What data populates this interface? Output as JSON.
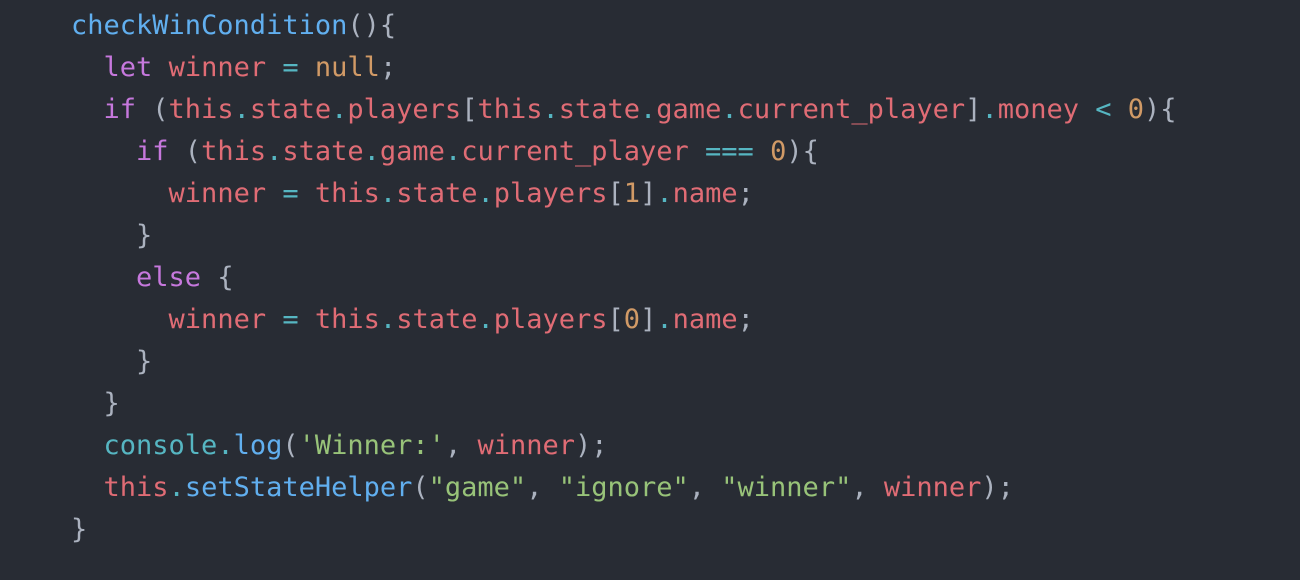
{
  "editor": {
    "theme_colors": {
      "background": "#282c34",
      "function": "#61afef",
      "keyword": "#c678dd",
      "variable": "#e06c75",
      "number": "#d19a66",
      "string": "#98c379",
      "operator": "#56b6c2",
      "punctuation": "#abb2bf"
    },
    "lines": [
      {
        "indent": "",
        "tokens": [
          {
            "t": "checkWinCondition",
            "k": "fn"
          },
          {
            "t": "(){",
            "k": "pun"
          }
        ]
      },
      {
        "indent": "  ",
        "tokens": [
          {
            "t": "let",
            "k": "kw"
          },
          {
            "t": " ",
            "k": "pun"
          },
          {
            "t": "winner",
            "k": "var"
          },
          {
            "t": " ",
            "k": "pun"
          },
          {
            "t": "=",
            "k": "op"
          },
          {
            "t": " ",
            "k": "pun"
          },
          {
            "t": "null",
            "k": "num"
          },
          {
            "t": ";",
            "k": "pun"
          }
        ]
      },
      {
        "indent": "  ",
        "tokens": [
          {
            "t": "if",
            "k": "kw"
          },
          {
            "t": " (",
            "k": "pun"
          },
          {
            "t": "this",
            "k": "var"
          },
          {
            "t": ".",
            "k": "dot"
          },
          {
            "t": "state",
            "k": "var"
          },
          {
            "t": ".",
            "k": "dot"
          },
          {
            "t": "players",
            "k": "var"
          },
          {
            "t": "[",
            "k": "pun"
          },
          {
            "t": "this",
            "k": "var"
          },
          {
            "t": ".",
            "k": "dot"
          },
          {
            "t": "state",
            "k": "var"
          },
          {
            "t": ".",
            "k": "dot"
          },
          {
            "t": "game",
            "k": "var"
          },
          {
            "t": ".",
            "k": "dot"
          },
          {
            "t": "current_player",
            "k": "var"
          },
          {
            "t": "]",
            "k": "pun"
          },
          {
            "t": ".",
            "k": "dot"
          },
          {
            "t": "money",
            "k": "var"
          },
          {
            "t": " ",
            "k": "pun"
          },
          {
            "t": "<",
            "k": "op"
          },
          {
            "t": " ",
            "k": "pun"
          },
          {
            "t": "0",
            "k": "num"
          },
          {
            "t": "){",
            "k": "pun"
          }
        ]
      },
      {
        "indent": "    ",
        "tokens": [
          {
            "t": "if",
            "k": "kw"
          },
          {
            "t": " (",
            "k": "pun"
          },
          {
            "t": "this",
            "k": "var"
          },
          {
            "t": ".",
            "k": "dot"
          },
          {
            "t": "state",
            "k": "var"
          },
          {
            "t": ".",
            "k": "dot"
          },
          {
            "t": "game",
            "k": "var"
          },
          {
            "t": ".",
            "k": "dot"
          },
          {
            "t": "current_player",
            "k": "var"
          },
          {
            "t": " ",
            "k": "pun"
          },
          {
            "t": "===",
            "k": "op"
          },
          {
            "t": " ",
            "k": "pun"
          },
          {
            "t": "0",
            "k": "num"
          },
          {
            "t": "){",
            "k": "pun"
          }
        ]
      },
      {
        "indent": "      ",
        "tokens": [
          {
            "t": "winner",
            "k": "var"
          },
          {
            "t": " ",
            "k": "pun"
          },
          {
            "t": "=",
            "k": "op"
          },
          {
            "t": " ",
            "k": "pun"
          },
          {
            "t": "this",
            "k": "var"
          },
          {
            "t": ".",
            "k": "dot"
          },
          {
            "t": "state",
            "k": "var"
          },
          {
            "t": ".",
            "k": "dot"
          },
          {
            "t": "players",
            "k": "var"
          },
          {
            "t": "[",
            "k": "pun"
          },
          {
            "t": "1",
            "k": "num"
          },
          {
            "t": "]",
            "k": "pun"
          },
          {
            "t": ".",
            "k": "dot"
          },
          {
            "t": "name",
            "k": "var"
          },
          {
            "t": ";",
            "k": "pun"
          }
        ]
      },
      {
        "indent": "    ",
        "tokens": [
          {
            "t": "}",
            "k": "pun"
          }
        ]
      },
      {
        "indent": "    ",
        "tokens": [
          {
            "t": "else",
            "k": "kw"
          },
          {
            "t": " {",
            "k": "pun"
          }
        ]
      },
      {
        "indent": "      ",
        "tokens": [
          {
            "t": "winner",
            "k": "var"
          },
          {
            "t": " ",
            "k": "pun"
          },
          {
            "t": "=",
            "k": "op"
          },
          {
            "t": " ",
            "k": "pun"
          },
          {
            "t": "this",
            "k": "var"
          },
          {
            "t": ".",
            "k": "dot"
          },
          {
            "t": "state",
            "k": "var"
          },
          {
            "t": ".",
            "k": "dot"
          },
          {
            "t": "players",
            "k": "var"
          },
          {
            "t": "[",
            "k": "pun"
          },
          {
            "t": "0",
            "k": "num"
          },
          {
            "t": "]",
            "k": "pun"
          },
          {
            "t": ".",
            "k": "dot"
          },
          {
            "t": "name",
            "k": "var"
          },
          {
            "t": ";",
            "k": "pun"
          }
        ]
      },
      {
        "indent": "    ",
        "tokens": [
          {
            "t": "}",
            "k": "pun"
          }
        ]
      },
      {
        "indent": "  ",
        "tokens": [
          {
            "t": "}",
            "k": "pun"
          }
        ]
      },
      {
        "indent": "  ",
        "tokens": [
          {
            "t": "console",
            "k": "obj"
          },
          {
            "t": ".",
            "k": "dot"
          },
          {
            "t": "log",
            "k": "fn"
          },
          {
            "t": "(",
            "k": "pun"
          },
          {
            "t": "'Winner:'",
            "k": "str"
          },
          {
            "t": ", ",
            "k": "pun"
          },
          {
            "t": "winner",
            "k": "var"
          },
          {
            "t": ");",
            "k": "pun"
          }
        ]
      },
      {
        "indent": "  ",
        "tokens": [
          {
            "t": "this",
            "k": "var"
          },
          {
            "t": ".",
            "k": "dot"
          },
          {
            "t": "setStateHelper",
            "k": "fn"
          },
          {
            "t": "(",
            "k": "pun"
          },
          {
            "t": "\"game\"",
            "k": "str"
          },
          {
            "t": ", ",
            "k": "pun"
          },
          {
            "t": "\"ignore\"",
            "k": "str"
          },
          {
            "t": ", ",
            "k": "pun"
          },
          {
            "t": "\"winner\"",
            "k": "str"
          },
          {
            "t": ", ",
            "k": "pun"
          },
          {
            "t": "winner",
            "k": "var"
          },
          {
            "t": ");",
            "k": "pun"
          }
        ]
      },
      {
        "indent": "",
        "tokens": [
          {
            "t": "}",
            "k": "pun"
          }
        ]
      }
    ]
  }
}
